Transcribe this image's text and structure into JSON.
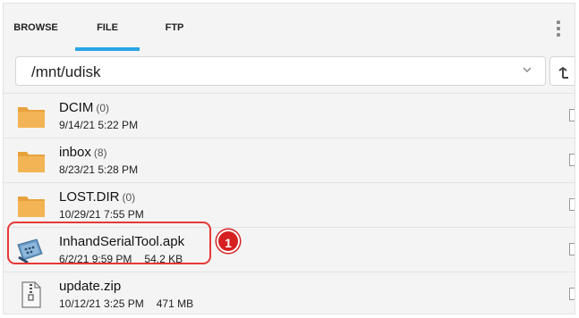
{
  "tabs": [
    {
      "label": "BROWSE"
    },
    {
      "label": "FILE"
    },
    {
      "label": "FTP"
    }
  ],
  "active_tab": "FILE",
  "accent_color": "#2aa3e6",
  "path": {
    "value": "/mnt/udisk"
  },
  "icons": {
    "menu": "more-vert-icon",
    "dropdown": "chevron-down-icon",
    "up": "up-directory-icon",
    "folder": "folder-icon",
    "apk": "serial-connector-icon",
    "zip": "zip-file-icon"
  },
  "files": [
    {
      "name": "DCIM",
      "count": "(0)",
      "date": "9/14/21 5:22 PM",
      "size": ""
    },
    {
      "name": "inbox",
      "count": "(8)",
      "date": "8/23/21 5:28 PM",
      "size": ""
    },
    {
      "name": "LOST.DIR",
      "count": "(0)",
      "date": "10/29/21 7:55 PM",
      "size": ""
    },
    {
      "name": "InhandSerialTool.apk",
      "count": "",
      "date": "6/2/21 9:59 PM",
      "size": "54.2 KB"
    },
    {
      "name": "update.zip",
      "count": "",
      "date": "10/12/21 3:25 PM",
      "size": "471 MB"
    }
  ],
  "annotation": {
    "label": "1",
    "color": "#d62020"
  }
}
